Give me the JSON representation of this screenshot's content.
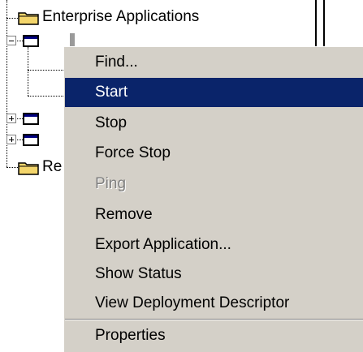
{
  "tree": {
    "root_label": "Enterprise Applications",
    "selected_node_label": "",
    "resources_label": "Re"
  },
  "context_menu": {
    "items": [
      {
        "label": "Find...",
        "state": "normal"
      },
      {
        "label": "Start",
        "state": "highlighted"
      },
      {
        "label": "Stop",
        "state": "normal"
      },
      {
        "label": "Force Stop",
        "state": "normal"
      },
      {
        "label": "Ping",
        "state": "disabled"
      },
      {
        "label": "Remove",
        "state": "normal"
      },
      {
        "label": "Export Application...",
        "state": "normal"
      },
      {
        "label": "Show Status",
        "state": "normal"
      },
      {
        "label": "View Deployment Descriptor",
        "state": "normal"
      },
      {
        "label": "Properties",
        "state": "normal"
      }
    ]
  },
  "colors": {
    "menu_background": "#d4d0c8",
    "highlight": "#0a246a",
    "disabled_text": "#808080",
    "folder_yellow": "#f3d56b"
  }
}
